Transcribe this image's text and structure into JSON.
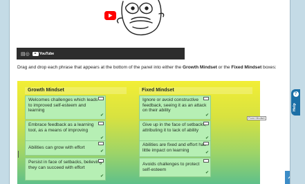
{
  "video": {
    "controls": {
      "captions_icon": "cc-icon",
      "logo_text": "YouTube"
    }
  },
  "instructions": {
    "prefix": "Drag and drop each phrase that appears at the bottom of the panel into either the ",
    "growth": "Growth Mindset",
    "middle": " or the ",
    "fixed": "Fixed Mindset",
    "suffix": " boxes:"
  },
  "board": {
    "growth_heading": "Growth Mindset",
    "fixed_heading": "Fixed Mindset",
    "growth_cards": [
      "Welcomes challenges which leads to improved self-esteem and learning",
      "Embrace feedback as a learning tool, as a means of improving",
      "Abilities can grow with effort",
      "Persist in face of setbacks, believing they can succeed with effort"
    ],
    "fixed_cards": [
      "Ignore or avoid constructive feedback, seeing it as an attack on their ability",
      "Give up in the face of setbacks, attributing it to lack of ability",
      "Abilities are fixed and effort has little impact on learning",
      "Avoids challenges to protect self-esteem"
    ],
    "tooltip": "Fixed Mindset"
  },
  "help": {
    "label": "Help",
    "icon": "?"
  },
  "colors": {
    "card_bg": "#b6efb4",
    "accent": "#1b6fa6",
    "scroll_button": "#3c8cc7"
  }
}
